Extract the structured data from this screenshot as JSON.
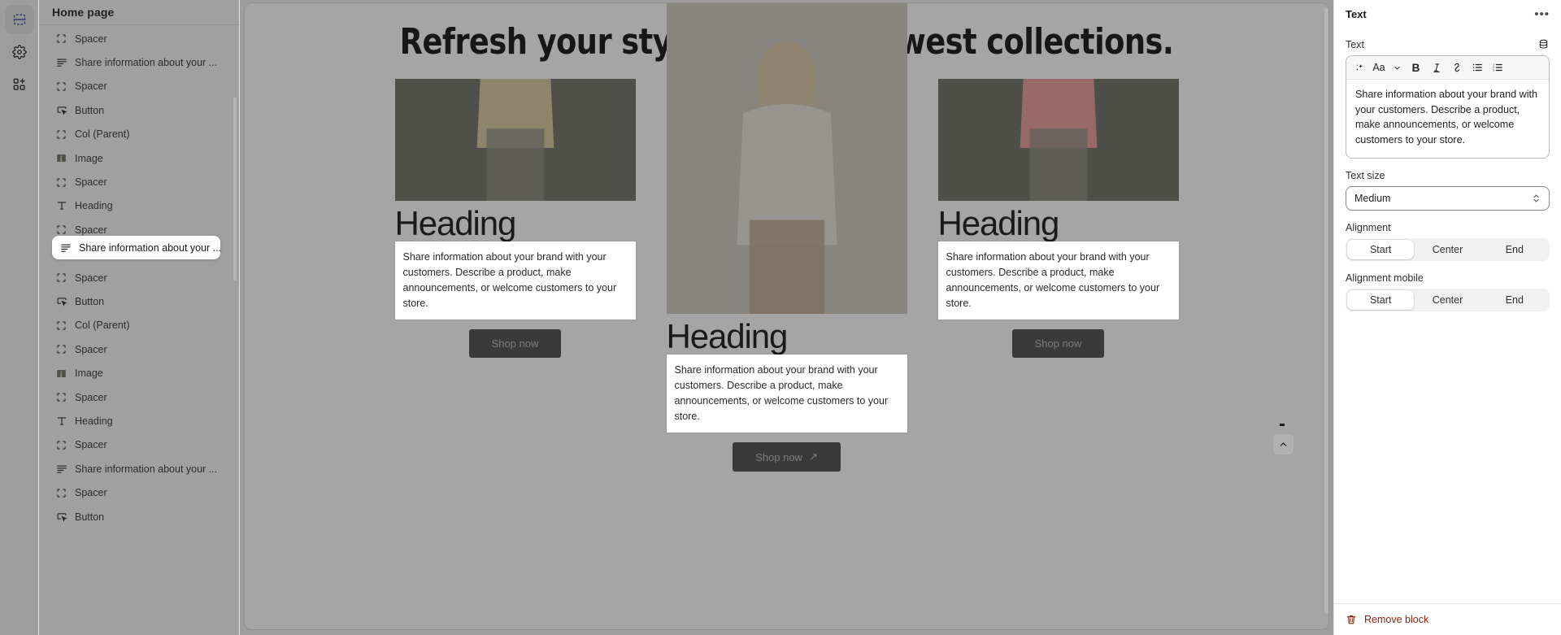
{
  "rail": {
    "items": [
      {
        "name": "sections-icon",
        "label": "Sections",
        "active": true
      },
      {
        "name": "gear-icon",
        "label": "Settings",
        "active": false
      },
      {
        "name": "apps-add-icon",
        "label": "Apps",
        "active": false
      }
    ]
  },
  "sidebar": {
    "title": "Home page",
    "items": [
      {
        "icon": "spacer-icon",
        "label": "Spacer"
      },
      {
        "icon": "text-icon",
        "label": "Share information about your ..."
      },
      {
        "icon": "spacer-icon",
        "label": "Spacer"
      },
      {
        "icon": "button-icon",
        "label": "Button"
      },
      {
        "icon": "spacer-icon",
        "label": "Col (Parent)"
      },
      {
        "icon": "image-icon",
        "label": "Image"
      },
      {
        "icon": "spacer-icon",
        "label": "Spacer"
      },
      {
        "icon": "heading-icon",
        "label": "Heading"
      },
      {
        "icon": "spacer-icon",
        "label": "Spacer"
      },
      {
        "icon": "text-icon",
        "label": "Share information about your ...",
        "selected": true
      },
      {
        "icon": "spacer-icon",
        "label": "Spacer"
      },
      {
        "icon": "button-icon",
        "label": "Button"
      },
      {
        "icon": "spacer-icon",
        "label": "Col (Parent)"
      },
      {
        "icon": "spacer-icon",
        "label": "Spacer"
      },
      {
        "icon": "image-icon",
        "label": "Image"
      },
      {
        "icon": "spacer-icon",
        "label": "Spacer"
      },
      {
        "icon": "heading-icon",
        "label": "Heading"
      },
      {
        "icon": "spacer-icon",
        "label": "Spacer"
      },
      {
        "icon": "text-icon",
        "label": "Share information about your ..."
      },
      {
        "icon": "spacer-icon",
        "label": "Spacer"
      },
      {
        "icon": "button-icon",
        "label": "Button"
      }
    ],
    "selected_label": "Share information about your ..."
  },
  "canvas": {
    "hero_title": "Refresh your style with the newest collections.",
    "cards": [
      {
        "heading": "Heading",
        "body": "Share information about your brand with your customers. Describe a product, make announcements, or welcome customers to your store.",
        "cta": "Shop now",
        "cta_arrow": ""
      },
      {
        "heading": "Heading",
        "body": "Share information about your brand with your customers. Describe a product, make announcements, or welcome customers to your store.",
        "cta": "Shop now",
        "cta_arrow": "↗"
      },
      {
        "heading": "Heading",
        "body": "Share information about your brand with your customers. Describe a product, make announcements, or welcome customers to your store.",
        "cta": "Shop now",
        "cta_arrow": ""
      }
    ]
  },
  "panel": {
    "title": "Text",
    "more_label": "•••",
    "text_field": {
      "label": "Text",
      "value": "Share information about your brand with your customers. Describe a product, make announcements, or welcome customers to your store.",
      "toolbar": [
        {
          "name": "magic-sparkle-icon",
          "label": "✦"
        },
        {
          "name": "font-size-icon",
          "label": "Aa"
        },
        {
          "name": "chevron-down-icon",
          "label": "⌄"
        },
        {
          "name": "bold-icon",
          "label": "B"
        },
        {
          "name": "italic-icon",
          "label": "I"
        },
        {
          "name": "link-icon",
          "label": "🔗"
        },
        {
          "name": "bulleted-list-icon",
          "label": "☰"
        },
        {
          "name": "numbered-list-icon",
          "label": "☰"
        }
      ]
    },
    "text_size": {
      "label": "Text size",
      "value": "Medium"
    },
    "alignment": {
      "label": "Alignment",
      "options": [
        "Start",
        "Center",
        "End"
      ],
      "selected": "Start"
    },
    "alignment_mobile": {
      "label": "Alignment mobile",
      "options": [
        "Start",
        "Center",
        "End"
      ],
      "selected": "Start"
    },
    "remove": {
      "label": "Remove block",
      "color": "#8e1f0b"
    }
  },
  "colors": {
    "accent": "#2c4a9c",
    "panel_bg": "#ffffff",
    "sidebar_bg": "#f6f6f7",
    "danger": "#8e1f0b"
  }
}
